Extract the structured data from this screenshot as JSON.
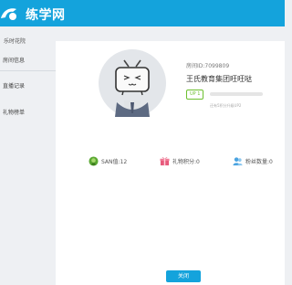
{
  "header": {
    "logo_text": "练学网"
  },
  "sidebar": {
    "top_label": "乐时花院",
    "items": [
      {
        "label": "房间信息"
      },
      {
        "label": "直播记录"
      },
      {
        "label": "礼物榜单"
      }
    ]
  },
  "profile": {
    "uid": "房间ID:7099809",
    "name": "王氏教育集团旺旺哒",
    "level": "UP 1",
    "exp_progress": 0,
    "exp_note": "还有5积分升级UP2"
  },
  "stats": [
    {
      "icon": "san-icon",
      "label": "SAN值:12"
    },
    {
      "icon": "gift-icon",
      "label": "礼物积分:0"
    },
    {
      "icon": "fans-icon",
      "label": "粉丝数量:0"
    }
  ],
  "close_button": {
    "label": "关闭"
  },
  "colors": {
    "accent": "#14a3dc",
    "level": "#6cbf2e"
  }
}
